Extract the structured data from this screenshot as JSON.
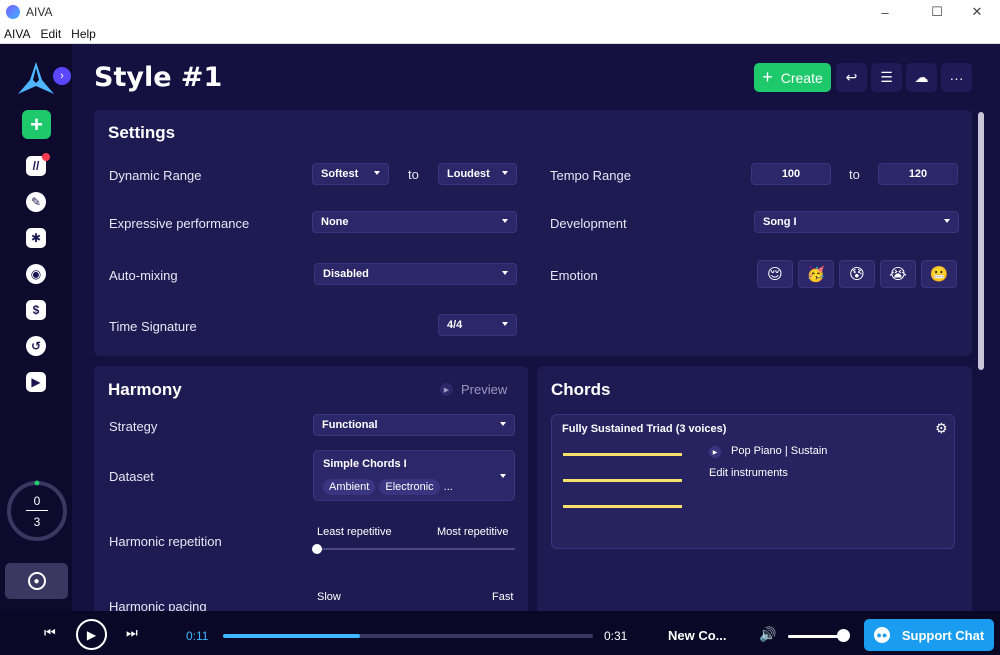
{
  "window": {
    "title": "AIVA",
    "minimize": "–",
    "maximize": "☐",
    "close": "✕"
  },
  "menu": [
    "AIVA",
    "Edit",
    "Help"
  ],
  "sidebar": {
    "score_top": "0",
    "score_bottom": "3"
  },
  "header": {
    "title": "Style #1",
    "create_label": "Create"
  },
  "settings": {
    "title": "Settings",
    "dynamic_range_label": "Dynamic Range",
    "dynamic_from": "Softest",
    "to_label": "to",
    "dynamic_to": "Loudest",
    "tempo_range_label": "Tempo Range",
    "tempo_from": "100",
    "tempo_to": "120",
    "expressive_label": "Expressive performance",
    "expressive_value": "None",
    "development_label": "Development",
    "development_value": "Song I",
    "automixing_label": "Auto-mixing",
    "automixing_value": "Disabled",
    "emotion_label": "Emotion",
    "emotions": [
      "😌",
      "🥳",
      "😰",
      "😭",
      "😬"
    ],
    "time_signature_label": "Time Signature",
    "time_signature_value": "4/4"
  },
  "harmony": {
    "title": "Harmony",
    "preview_label": "Preview",
    "strategy_label": "Strategy",
    "strategy_value": "Functional",
    "dataset_label": "Dataset",
    "dataset_value": "Simple Chords I",
    "dataset_tags": [
      "Ambient",
      "Electronic"
    ],
    "dataset_more": "...",
    "repetition_label": "Harmonic repetition",
    "repetition_min": "Least repetitive",
    "repetition_max": "Most repetitive",
    "repetition_level": 0,
    "pacing_label": "Harmonic pacing",
    "pacing_min": "Slow",
    "pacing_max": "Fast"
  },
  "chords": {
    "title": "Chords",
    "card_title": "Fully Sustained Triad (3 voices)",
    "instrument": "Pop Piano | Sustain",
    "edit_instruments": "Edit instruments"
  },
  "player": {
    "elapsed": "0:11",
    "duration": "0:31",
    "progress": 0.37,
    "track_title": "New Co...",
    "volume": 0.92,
    "support_label": "Support Chat"
  },
  "colors": {
    "accent_green": "#1ec96b",
    "progress_blue": "#3fb6ff",
    "chord_line": "#f5e16a",
    "support_blue": "#1a9df0"
  }
}
